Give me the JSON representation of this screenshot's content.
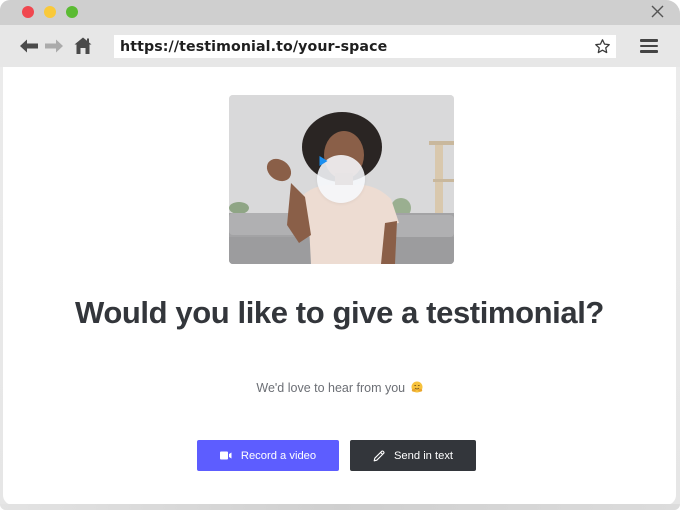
{
  "browser": {
    "url": "https://testimonial.to/your-space",
    "icons": {
      "close": "close-icon",
      "back": "arrow-left-icon",
      "forward": "arrow-right-icon",
      "home": "home-icon",
      "bookmark": "star-icon",
      "menu": "hamburger-menu-icon"
    },
    "colors": {
      "traffic_red": "#f0474f",
      "traffic_yellow": "#f9c93a",
      "traffic_green": "#5bbb33"
    }
  },
  "page": {
    "video": {
      "play_icon": "play-icon",
      "play_color": "#1a8ff0"
    },
    "headline": "Would you like to give a testimonial?",
    "subtitle": "We'd love to hear from you",
    "subtitle_emoji": "hugging-face-emoji",
    "buttons": {
      "record_video": "Record a video",
      "send_text": "Send in text"
    },
    "colors": {
      "primary": "#5d5dff",
      "secondary": "#33363b",
      "headline": "#33363b"
    }
  }
}
